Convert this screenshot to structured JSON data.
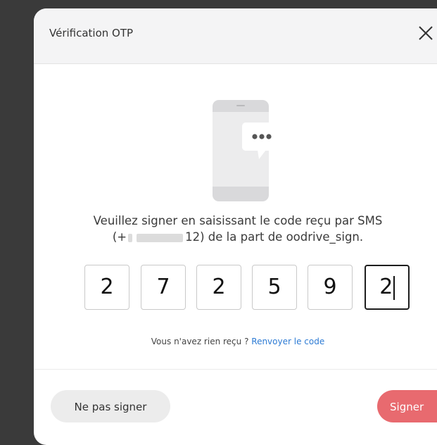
{
  "dialog": {
    "title": "Vérification OTP"
  },
  "message": {
    "line1": "Veuillez signer en saisissant le code reçu par SMS",
    "line2_prefix": "(+",
    "line2_phone_suffix": "12)",
    "line2_rest": " de la part de oodrive_sign."
  },
  "otp": {
    "digits": [
      "2",
      "7",
      "2",
      "5",
      "9",
      "2"
    ]
  },
  "resend": {
    "text": "Vous n'avez rien reçu ?",
    "link": "Renvoyer le code"
  },
  "footer": {
    "decline_label": "Ne pas signer",
    "sign_label": "Signer"
  },
  "colors": {
    "sign_button": "#e86a6f",
    "link": "#2d7bd4",
    "backdrop": "#3a3a3a"
  },
  "icons": {
    "close": "close-icon",
    "illustration": "phone-sms-illustration"
  }
}
